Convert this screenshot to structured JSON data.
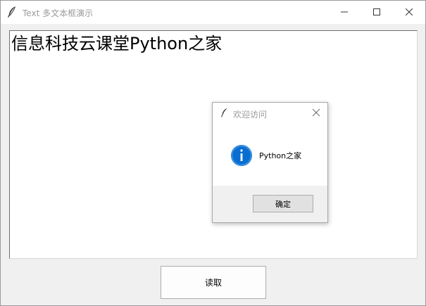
{
  "window": {
    "title": "Text 多文本框演示",
    "icon": "tk-feather-icon",
    "controls": {
      "minimize_icon": "minimize-icon",
      "maximize_icon": "maximize-icon",
      "close_icon": "close-icon"
    }
  },
  "textbox": {
    "content": "信息科技云课堂Python之家"
  },
  "read_button": {
    "label": "读取"
  },
  "dialog": {
    "title": "欢迎访问",
    "icon": "info-icon",
    "message": "Python之家",
    "ok_label": "确定"
  },
  "colors": {
    "window_bg": "#f0f0f0",
    "titlebar_text": "#9b9b9b",
    "info_blue": "#0a6ed1"
  }
}
